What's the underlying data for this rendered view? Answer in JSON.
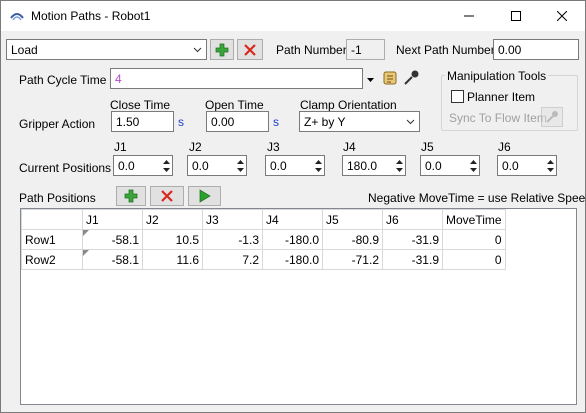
{
  "window": {
    "title": "Motion Paths - Robot1"
  },
  "path": {
    "selected": "Load",
    "number_label": "Path Number",
    "number_value": "-1",
    "next_label": "Next Path Number",
    "next_value": "0.00"
  },
  "cycle": {
    "label": "Path Cycle Time",
    "value": "4"
  },
  "manip": {
    "title": "Manipulation Tools",
    "planner_label": "Planner Item",
    "sync_label": "Sync To Flow Item"
  },
  "gripper": {
    "label": "Gripper Action",
    "close_label": "Close Time",
    "close_value": "1.50",
    "close_unit": "s",
    "open_label": "Open Time",
    "open_value": "0.00",
    "open_unit": "s",
    "clamp_label": "Clamp Orientation",
    "clamp_value": "Z+ by Y"
  },
  "current": {
    "label": "Current Positions",
    "joints": [
      {
        "name": "J1",
        "value": "0.0"
      },
      {
        "name": "J2",
        "value": "0.0"
      },
      {
        "name": "J3",
        "value": "0.0"
      },
      {
        "name": "J4",
        "value": "180.0"
      },
      {
        "name": "J5",
        "value": "0.0"
      },
      {
        "name": "J6",
        "value": "0.0"
      }
    ]
  },
  "positions": {
    "label": "Path Positions",
    "hint": "Negative MoveTime = use Relative Speeds",
    "columns": [
      "J1",
      "J2",
      "J3",
      "J4",
      "J5",
      "J6",
      "MoveTime"
    ],
    "rows": [
      {
        "name": "Row1",
        "cells": [
          "-58.1",
          "10.5",
          "-1.3",
          "-180.0",
          "-80.9",
          "-31.9",
          "0"
        ]
      },
      {
        "name": "Row2",
        "cells": [
          "-58.1",
          "11.6",
          "7.2",
          "-180.0",
          "-71.2",
          "-31.9",
          "0"
        ]
      }
    ]
  },
  "colors": {
    "accent_green": "#3aa53a",
    "delete_red": "#d9281e",
    "unit_blue": "#1a3fc4",
    "cycle_value": "#b14dc4"
  }
}
